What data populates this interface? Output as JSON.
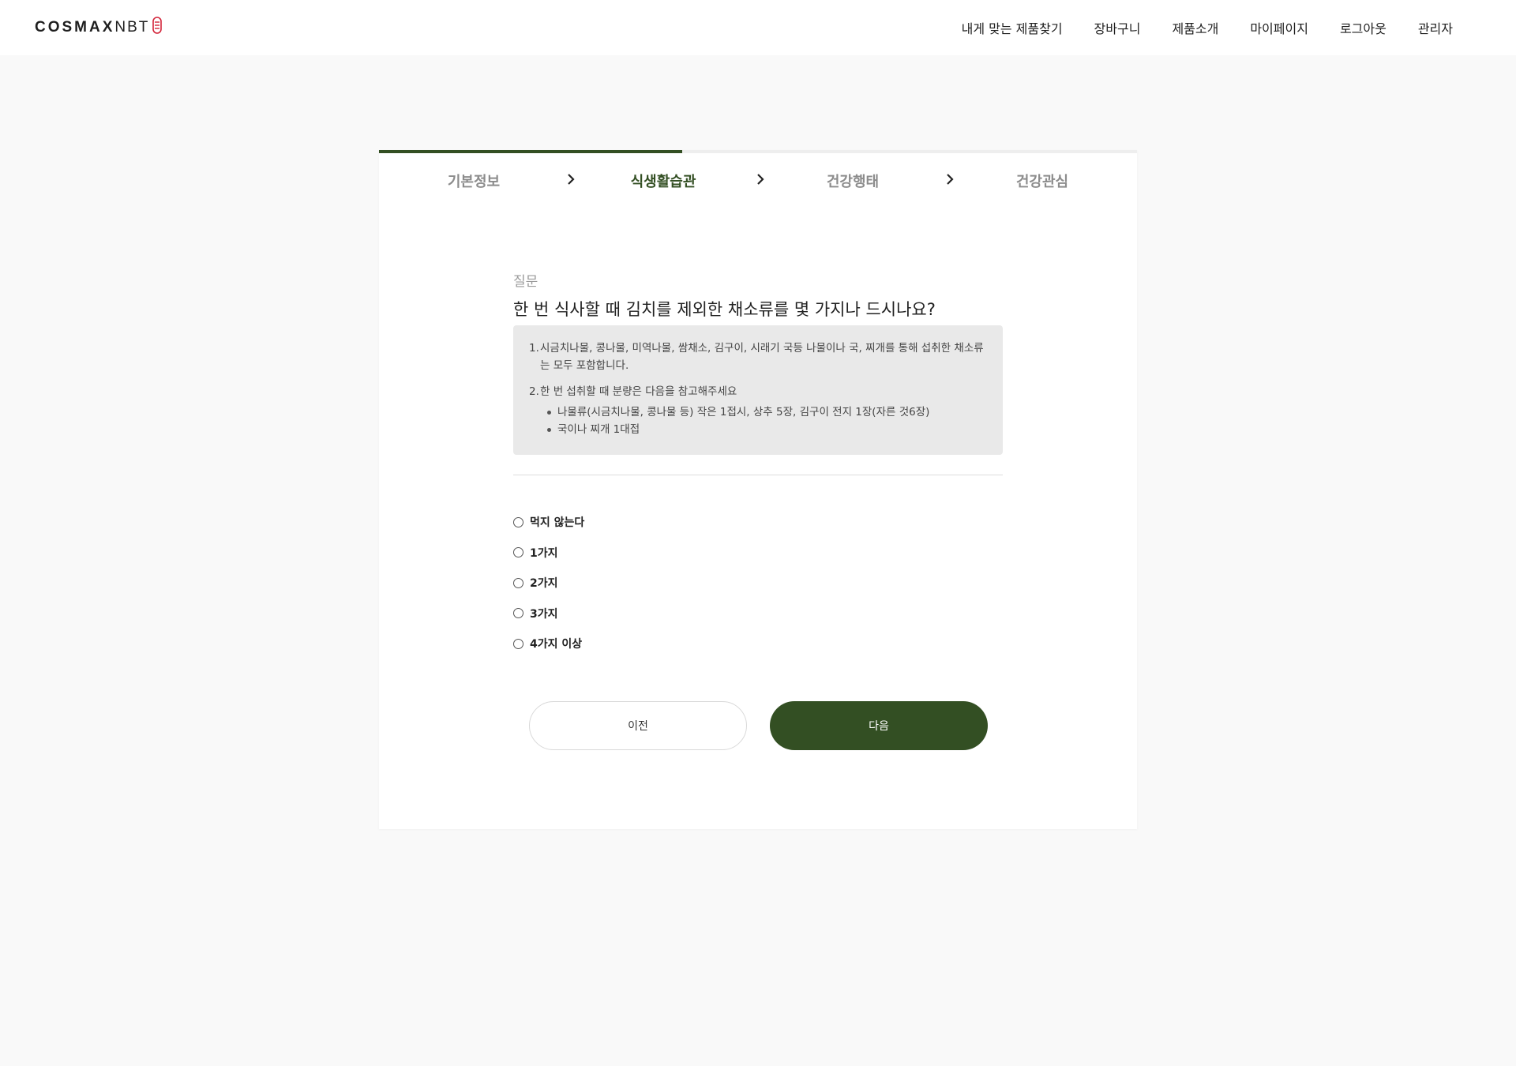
{
  "header": {
    "logo_bold": "COSMAX",
    "logo_light": "NBT",
    "nav": [
      "내게 맞는 제품찾기",
      "장바구니",
      "제품소개",
      "마이페이지",
      "로그아웃",
      "관리자"
    ]
  },
  "steps": {
    "items": [
      "기본정보",
      "식생활습관",
      "건강행태",
      "건강관심"
    ],
    "active_index": 1,
    "progress_fraction": 0.4
  },
  "question": {
    "label": "질문",
    "title": "한 번 식사할 때 김치를 제외한 채소류를 몇 가지나 드시나요?",
    "notes": {
      "p1_num": "1.",
      "p1_text": "시금치나물, 콩나물, 미역나물, 쌈채소, 김구이, 시래기 국등 나물이나 국, 찌개를 통해 섭취한 채소류는 모두 포함합니다.",
      "p2_num": "2.",
      "p2_text": "한 번 섭취할 때 분량은 다음을 참고해주세요",
      "bullets": [
        "나물류(시금치나물, 콩나물 등) 작은 1접시, 상추 5장, 김구이 전지 1장(자른 것6장)",
        "국이나 찌개 1대접"
      ]
    },
    "options": [
      "먹지 않는다",
      "1가지",
      "2가지",
      "3가지",
      "4가지 이상"
    ]
  },
  "buttons": {
    "prev": "이전",
    "next": "다음"
  },
  "colors": {
    "accent": "#334f23",
    "background": "#f9f9f9",
    "info_box": "#e9e9e9"
  },
  "icons": {
    "step_separator": "chevron-right-icon",
    "logo_mark": "logo-mark-icon"
  }
}
